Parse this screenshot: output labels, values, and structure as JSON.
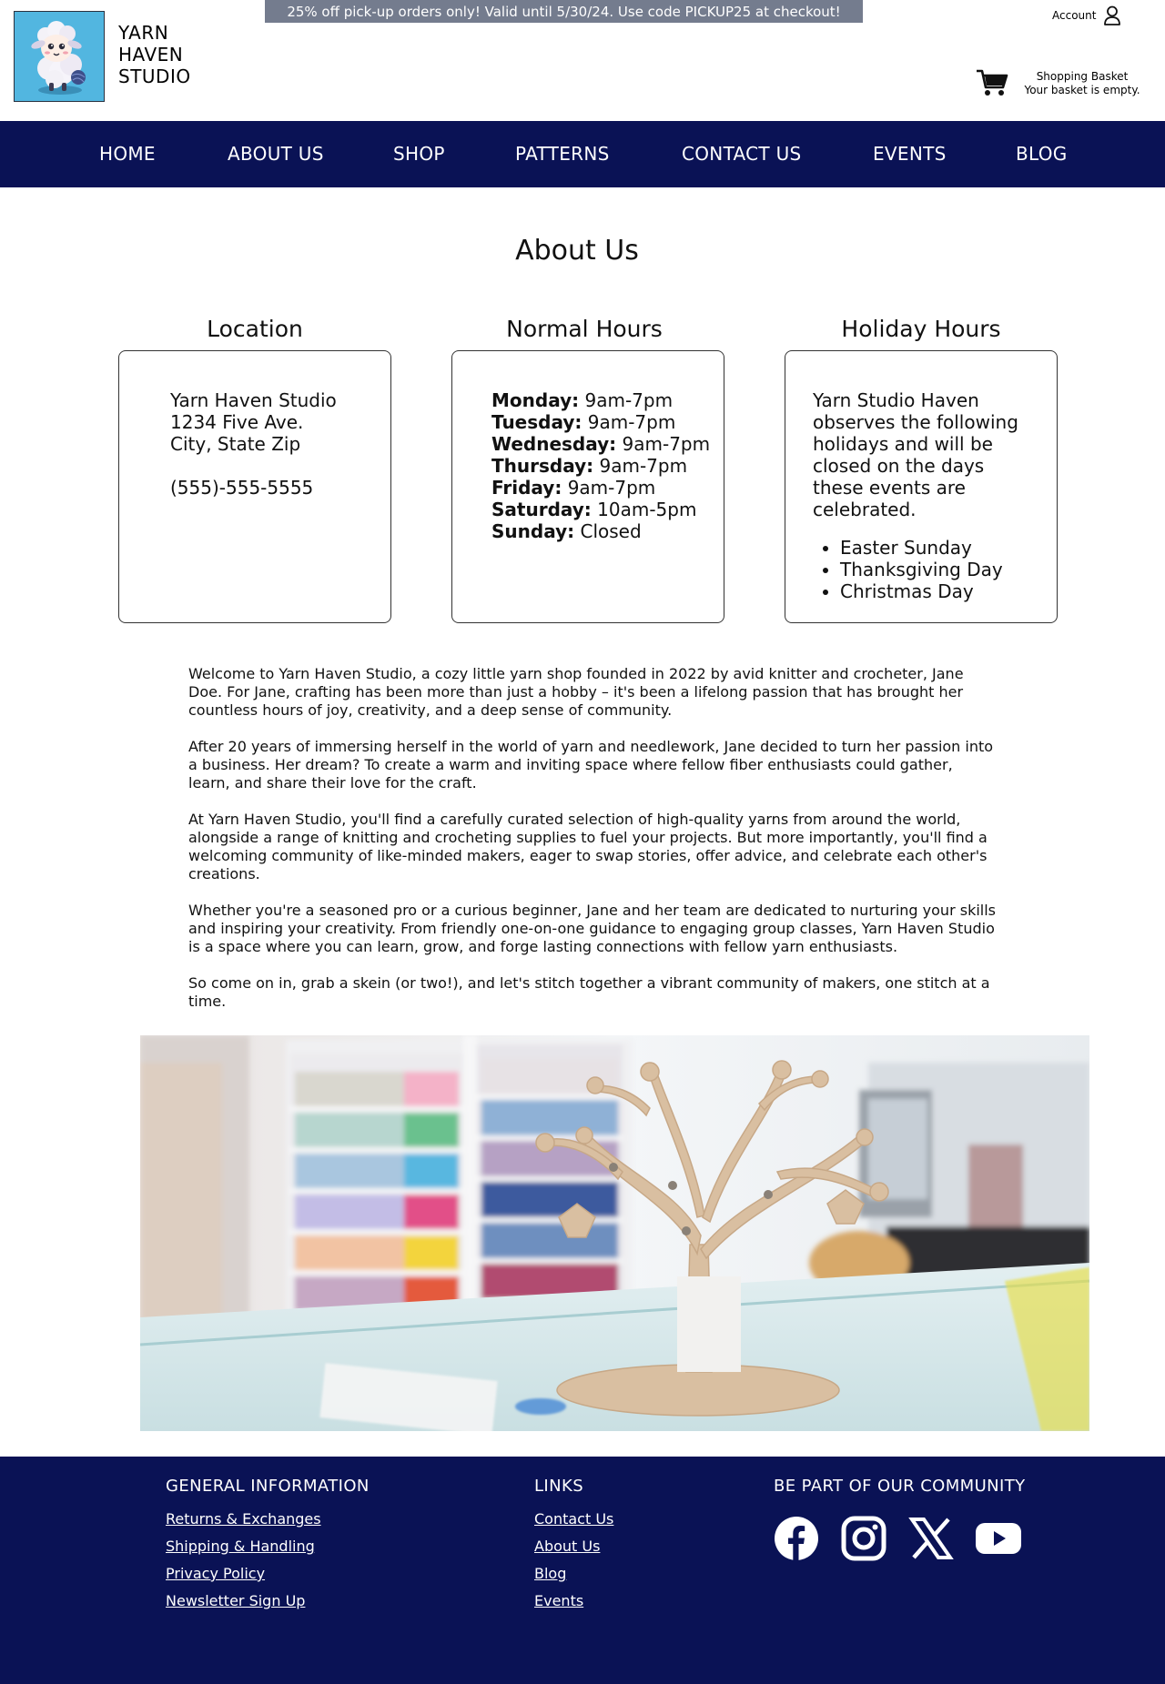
{
  "promo": "25% off pick-up orders only! Valid until 5/30/24. Use code PICKUP25 at checkout!",
  "brand": {
    "line1": "YARN",
    "line2": "HAVEN",
    "line3": "STUDIO"
  },
  "account": {
    "label": "Account",
    "icon": "user-icon"
  },
  "basket": {
    "title": "Shopping Basket",
    "status": "Your basket is empty.",
    "icon": "cart-icon"
  },
  "nav": [
    "HOME",
    "ABOUT US",
    "SHOP",
    "PATTERNS",
    "CONTACT US",
    "EVENTS",
    "BLOG"
  ],
  "page_title": "About Us",
  "location": {
    "title": "Location",
    "name": "Yarn Haven Studio",
    "street": "1234 Five Ave.",
    "city": "City, State Zip",
    "phone": "(555)-555-5555"
  },
  "hours": {
    "title": "Normal Hours",
    "rows": [
      {
        "day": "Monday",
        "time": " 9am-7pm"
      },
      {
        "day": "Tuesday",
        "time": " 9am-7pm"
      },
      {
        "day": "Wednesday",
        "time": " 9am-7pm"
      },
      {
        "day": "Thursday",
        "time": " 9am-7pm"
      },
      {
        "day": "Friday",
        "time": " 9am-7pm"
      },
      {
        "day": "Saturday",
        "time": " 10am-5pm"
      },
      {
        "day": "Sunday",
        "time": " Closed"
      }
    ]
  },
  "holiday": {
    "title": "Holiday Hours",
    "text": "Yarn Studio Haven observes the following holidays and will be closed on the days these events are celebrated.",
    "items": [
      "Easter Sunday",
      "Thanksgiving Day",
      "Christmas Day"
    ]
  },
  "paragraphs": [
    "Welcome to Yarn Haven Studio, a cozy little yarn shop founded in 2022 by avid knitter and crocheter, Jane Doe. For Jane, crafting has been more than just a hobby – it's been a lifelong passion that has brought her countless hours of joy, creativity, and a deep sense of community.",
    "After 20 years of immersing herself in the world of yarn and needlework, Jane decided to turn her passion into a business. Her dream? To create a warm and inviting space where fellow fiber enthusiasts could gather, learn, and share their love for the craft.",
    "At Yarn Haven Studio, you'll find a carefully curated selection of high-quality yarns from around the world, alongside a range of knitting and crocheting supplies to fuel your projects. But more importantly, you'll find a welcoming community of like-minded makers, eager to swap stories, offer advice, and celebrate each other's creations.",
    "Whether you're a seasoned pro or a curious beginner, Jane and her team are dedicated to nurturing your skills and inspiring your creativity. From friendly one-on-one guidance to engaging group classes, Yarn Haven Studio is a space where you can learn, grow, and forge lasting connections with fellow yarn enthusiasts.",
    "So come on in, grab a skein (or two!), and let's stitch together a vibrant community of makers, one stitch at a time."
  ],
  "footer": {
    "general": {
      "title": "GENERAL INFORMATION",
      "links": [
        "Returns & Exchanges",
        "Shipping & Handling",
        "Privacy Policy",
        "Newsletter Sign Up"
      ]
    },
    "links": {
      "title": "LINKS",
      "links": [
        "Contact Us",
        "About Us",
        "Blog",
        "Events"
      ]
    },
    "community": {
      "title": "BE PART OF OUR COMMUNITY",
      "icons": [
        "facebook-icon",
        "instagram-icon",
        "x-icon",
        "youtube-icon"
      ]
    }
  },
  "colors": {
    "nav_bg": "#0a1255",
    "promo_bg": "#747c8e",
    "logo_bg": "#4fb4de"
  }
}
